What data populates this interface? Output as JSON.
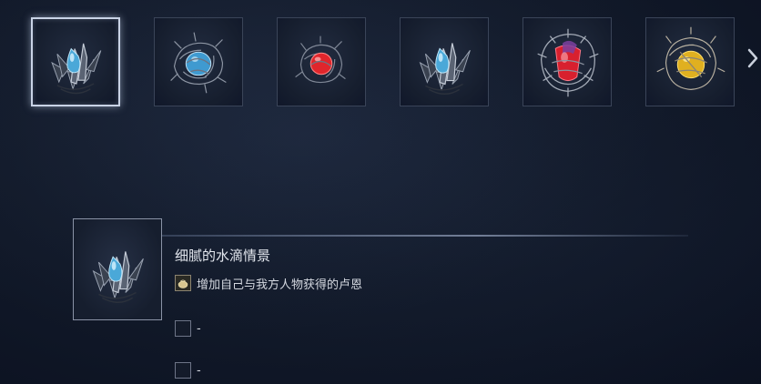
{
  "items": [
    {
      "name": "crystal-shard-blue",
      "gem_color": "#4aa8d8",
      "selected": true
    },
    {
      "name": "thorn-nest-blue",
      "gem_color": "#3f9ad0",
      "selected": false
    },
    {
      "name": "thorn-nest-red",
      "gem_color": "#e0262c",
      "selected": false
    },
    {
      "name": "crystal-shard-blue",
      "gem_color": "#4aa8d8",
      "selected": false
    },
    {
      "name": "branch-red-large",
      "gem_color": "#d8202e",
      "selected": false
    },
    {
      "name": "thorn-nest-gold",
      "gem_color": "#e0b020",
      "selected": false
    }
  ],
  "nav": {
    "next_icon": "chevron-right-icon"
  },
  "detail": {
    "name": "细腻的水滴情景",
    "effects": [
      {
        "icon": "pouch-icon",
        "text": "增加自己与我方人物获得的卢恩"
      },
      {
        "icon": "empty-slot",
        "text": "-"
      },
      {
        "icon": "empty-slot",
        "text": "-"
      }
    ]
  },
  "colors": {
    "accent_border": "#c9d3e6",
    "background": "#121a2a"
  }
}
